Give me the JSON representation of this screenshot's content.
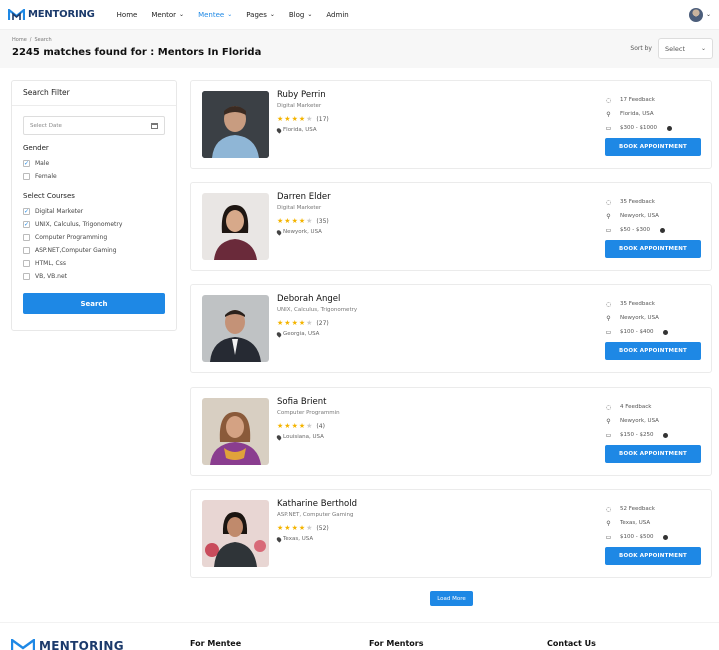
{
  "header": {
    "logo_text": "MENTORING",
    "nav": [
      {
        "label": "Home",
        "has_dropdown": false,
        "active": false
      },
      {
        "label": "Mentor",
        "has_dropdown": true,
        "active": false
      },
      {
        "label": "Mentee",
        "has_dropdown": true,
        "active": true
      },
      {
        "label": "Pages",
        "has_dropdown": true,
        "active": false
      },
      {
        "label": "Blog",
        "has_dropdown": true,
        "active": false
      },
      {
        "label": "Admin",
        "has_dropdown": false,
        "active": false
      }
    ]
  },
  "breadcrumb": {
    "home": "Home",
    "separator": "/",
    "current": "Search"
  },
  "results_title": "2245 matches found for : Mentors In Florida",
  "sort": {
    "label": "Sort by",
    "value": "Select"
  },
  "filter": {
    "title": "Search Filter",
    "date_placeholder": "Select Date",
    "gender_title": "Gender",
    "gender": [
      {
        "label": "Male",
        "checked": true
      },
      {
        "label": "Female",
        "checked": false
      }
    ],
    "courses_title": "Select Courses",
    "courses": [
      {
        "label": "Digital Marketer",
        "checked": true
      },
      {
        "label": "UNIX, Calculus, Trigonometry",
        "checked": true
      },
      {
        "label": "Computer Programming",
        "checked": false
      },
      {
        "label": "ASP.NET,Computer Gaming",
        "checked": false
      },
      {
        "label": "HTML, Css",
        "checked": false
      },
      {
        "label": "VB, VB.net",
        "checked": false
      }
    ],
    "search_label": "Search"
  },
  "mentors": [
    {
      "name": "Ruby Perrin",
      "role": "Digital Marketer",
      "rating": 4,
      "reviews": "(17)",
      "location": "Florida, USA",
      "feedback": "17 Feedback",
      "city": "Florida, USA",
      "price": "$300 - $1000",
      "book": "BOOK APPOINTMENT"
    },
    {
      "name": "Darren Elder",
      "role": "Digital Marketer",
      "rating": 4,
      "reviews": "(35)",
      "location": "Newyork, USA",
      "feedback": "35 Feedback",
      "city": "Newyork, USA",
      "price": "$50 - $300",
      "book": "BOOK APPOINTMENT"
    },
    {
      "name": "Deborah Angel",
      "role": "UNIX, Calculus, Trigonometry",
      "rating": 4,
      "reviews": "(27)",
      "location": "Georgia, USA",
      "feedback": "35 Feedback",
      "city": "Newyork, USA",
      "price": "$100 - $400",
      "book": "BOOK APPOINTMENT"
    },
    {
      "name": "Sofia Brient",
      "role": "Computer Programmin",
      "rating": 4,
      "reviews": "(4)",
      "location": "Louisiana, USA",
      "feedback": "4 Feedback",
      "city": "Newyork, USA",
      "price": "$150 - $250",
      "book": "BOOK APPOINTMENT"
    },
    {
      "name": "Katharine Berthold",
      "role": "ASP.NET, Computer Gaming",
      "rating": 4,
      "reviews": "(52)",
      "location": "Texas, USA",
      "feedback": "52 Feedback",
      "city": "Texas, USA",
      "price": "$100 - $500",
      "book": "BOOK APPOINTMENT"
    }
  ],
  "load_more": "Load More",
  "footer": {
    "logo_text": "MENTORING",
    "col1": "For Mentee",
    "col2": "For Mentors",
    "col3": "Contact Us"
  },
  "colors": {
    "accent": "#1e88e5",
    "brand": "#1b3a6b",
    "star": "#f4b400"
  }
}
